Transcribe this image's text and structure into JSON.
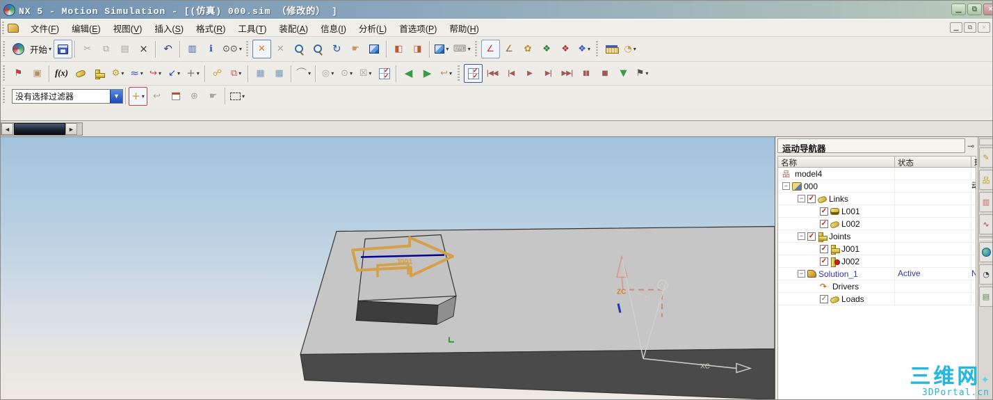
{
  "window": {
    "title": "NX 5 - Motion Simulation - [(仿真) 000.sim （修改的） ]",
    "main_controls": [
      {
        "n": "minimize-button",
        "g": "▁",
        "k": "min"
      },
      {
        "n": "restore-button",
        "g": "⧉",
        "k": "restore"
      },
      {
        "n": "close-button",
        "g": "×",
        "k": "close"
      }
    ],
    "child_controls": [
      {
        "n": "child-minimize-button",
        "g": "▁",
        "k": "min"
      },
      {
        "n": "child-restore-button",
        "g": "⧉",
        "k": "restore"
      },
      {
        "n": "child-close-button",
        "g": "×",
        "k": "close"
      }
    ]
  },
  "menu_bar": {
    "items": [
      {
        "id": "file",
        "label": "文件(F)"
      },
      {
        "id": "edit",
        "label": "编辑(E)"
      },
      {
        "id": "view",
        "label": "视图(V)"
      },
      {
        "id": "insert",
        "label": "插入(S)"
      },
      {
        "id": "format",
        "label": "格式(R)"
      },
      {
        "id": "tools",
        "label": "工具(T)"
      },
      {
        "id": "assemblies",
        "label": "装配(A)"
      },
      {
        "id": "information",
        "label": "信息(I)"
      },
      {
        "id": "analysis",
        "label": "分析(L)"
      },
      {
        "id": "preferences",
        "label": "首选项(P)"
      },
      {
        "id": "help",
        "label": "帮助(H)"
      }
    ]
  },
  "selection_filter": {
    "value": "没有选择过滤器"
  },
  "toolbars": [
    {
      "dom": "toolbar-row-1",
      "groups": [
        {
          "grip": true,
          "items": [
            {
              "n": "nx-logo-icon",
              "cls": "ic-nxlogo",
              "deco": true
            },
            {
              "n": "start-menu-button",
              "lb": "开始",
              "d": 1
            },
            {
              "n": "save-button",
              "cls": "ic-save",
              "box": "#8aa0c0"
            }
          ]
        },
        {
          "items": [
            {
              "n": "cut-button",
              "g": "✂",
              "dis": 1
            },
            {
              "n": "copy-button",
              "g": "⧉",
              "dis": 1
            },
            {
              "n": "paste-button",
              "g": "▤",
              "dis": 1
            },
            {
              "n": "delete-button",
              "g": "×",
              "c": "#333",
              "big": 1
            }
          ]
        },
        {
          "items": [
            {
              "n": "undo-button",
              "g": "↶",
              "c": "#334477",
              "big": 1
            }
          ]
        },
        {
          "items": [
            {
              "n": "display-properties-button",
              "g": "▥",
              "c": "#4466aa"
            },
            {
              "n": "information-button",
              "g": "ℹ",
              "c": "#2a52c8"
            },
            {
              "n": "find-button",
              "g": "⊙⊙",
              "c": "#4a4438",
              "d": 1
            }
          ]
        },
        {
          "grip": true,
          "items": [
            {
              "n": "fit-view-button",
              "g": "✕",
              "c": "#e07820",
              "box": "#5a82c8"
            },
            {
              "n": "fit-selection-button",
              "g": "✕",
              "dis": 1
            },
            {
              "n": "zoom-box-button",
              "cls": "ic-mag"
            },
            {
              "n": "zoom-in-out-button",
              "cls": "ic-mag"
            },
            {
              "n": "rotate-view-button",
              "g": "↻",
              "c": "#2255bb",
              "big": 1
            },
            {
              "n": "pan-view-button",
              "g": "☛",
              "c": "#c89a60"
            },
            {
              "n": "perspective-button",
              "cls": "ic-cube"
            }
          ]
        },
        {
          "items": [
            {
              "n": "move-link-button",
              "g": "◧",
              "c": "#b85a3a"
            },
            {
              "n": "smart-move-button",
              "g": "◨",
              "c": "#b85a3a"
            }
          ]
        },
        {
          "items": [
            {
              "n": "rendering-style-button",
              "cls": "ic-cube",
              "d": 1
            },
            {
              "n": "visualization-button",
              "g": "⌨",
              "c": "#8a8880",
              "d": 1
            }
          ]
        },
        {
          "grip": true,
          "items": [
            {
              "n": "orient-csys-button",
              "g": "∠",
              "c": "#cc3333",
              "box": "#8aa0b8"
            },
            {
              "n": "dynamic-csys-button",
              "g": "∠",
              "c": "#996644"
            },
            {
              "n": "role-palette-button",
              "g": "✿",
              "c": "#cc8833"
            },
            {
              "n": "standard-views-button",
              "g": "❖",
              "c": "#2a7a3a"
            },
            {
              "n": "view-operations-button",
              "g": "❖",
              "c": "#aa3333"
            },
            {
              "n": "more-views-button",
              "g": "❖",
              "c": "#3355cc",
              "d": 1
            }
          ]
        },
        {
          "grip": true,
          "items": [
            {
              "n": "measure-distance-button",
              "cls": "ic-ruler"
            },
            {
              "n": "measure-angle-button",
              "g": "◔",
              "c": "#c8a050",
              "d": 1
            }
          ]
        }
      ]
    },
    {
      "dom": "toolbar-row-2",
      "groups": [
        {
          "grip": true,
          "items": [
            {
              "n": "motion-environment-button",
              "g": "⚑",
              "c": "#cc3344"
            },
            {
              "n": "motion-body-button",
              "g": "▣",
              "c": "#b09060"
            }
          ]
        },
        {
          "items": [
            {
              "n": "function-manager-button",
              "lb": "f(x)",
              "fx": 1
            },
            {
              "n": "link-button",
              "cls": "ic-link"
            },
            {
              "n": "joint-button",
              "cls": "ic-joint"
            },
            {
              "n": "gear-button",
              "g": "⚙",
              "c": "#c89a20",
              "d": 1
            },
            {
              "n": "spring-button",
              "g": "≈",
              "c": "#4455cc",
              "big": 1,
              "d": 1
            },
            {
              "n": "curve-contact-button",
              "g": "↪",
              "c": "#cc4444",
              "d": 1
            },
            {
              "n": "vector-force-button",
              "g": "↙",
              "c": "#2244cc",
              "d": 1
            },
            {
              "n": "marker-button",
              "g": "+",
              "c": "#77736a",
              "big": 1,
              "d": 1
            }
          ]
        },
        {
          "items": [
            {
              "n": "friction-button",
              "g": "☍",
              "c": "#c8a030"
            },
            {
              "n": "interference-button",
              "g": "⧉",
              "c": "#cc5555",
              "d": 1
            }
          ]
        },
        {
          "items": [
            {
              "n": "solve-button",
              "g": "▦",
              "c": "#7799bb"
            },
            {
              "n": "solution-manager-button",
              "g": "▦",
              "c": "#7799bb"
            }
          ]
        },
        {
          "items": [
            {
              "n": "animation-control-button",
              "g": "⌒",
              "c": "#98948c",
              "big": 1,
              "d": 1
            }
          ]
        },
        {
          "items": [
            {
              "n": "graphing-button",
              "g": "◎",
              "dis": 1,
              "d": 1
            },
            {
              "n": "load-identification-button",
              "g": "⊙",
              "dis": 1,
              "d": 1
            },
            {
              "n": "spreadsheet-button",
              "g": "☒",
              "dis": 1,
              "d": 1
            },
            {
              "n": "load-transfer-button",
              "cls": "ic-gridcheck"
            }
          ]
        },
        {
          "items": [
            {
              "n": "previous-step-button",
              "g": "◀",
              "c": "#3a9a4a",
              "big": 1
            },
            {
              "n": "next-step-button",
              "g": "▶",
              "c": "#3a9a4a",
              "big": 1
            },
            {
              "n": "return-to-model-button",
              "g": "↩",
              "c": "#b09868",
              "d": 1
            }
          ]
        },
        {
          "grip": true,
          "items": [
            {
              "n": "animation-check-button",
              "cls": "ic-gridcheck",
              "box": "#3355aa"
            },
            {
              "n": "rewind-button",
              "g": "|◀◀",
              "c": "#a05858",
              "pb": 1
            },
            {
              "n": "step-back-button",
              "g": "|◀",
              "c": "#a05858",
              "pb": 1
            },
            {
              "n": "play-button",
              "g": "▶",
              "c": "#a05858",
              "pb": 1
            },
            {
              "n": "step-forward-button",
              "g": "▶|",
              "c": "#a05858",
              "pb": 1
            },
            {
              "n": "fast-forward-button",
              "g": "▶▶|",
              "c": "#a05858",
              "pb": 1
            },
            {
              "n": "pause-button",
              "g": "▮▮",
              "c": "#a05858",
              "pb": 1
            },
            {
              "n": "stop-button",
              "g": "■",
              "c": "#a05858",
              "pb": 1
            },
            {
              "n": "expand-animation-button",
              "g": "▼",
              "c": "#3a9a4a"
            },
            {
              "n": "finish-flag-button",
              "g": "⚑",
              "c": "#55524a",
              "d": 1
            }
          ]
        }
      ]
    },
    {
      "dom": "toolbar-row-3",
      "groups": [
        {
          "grip": true,
          "items": [
            {
              "n": "selection-filter-combo",
              "combo": 1
            }
          ]
        },
        {
          "items": [
            {
              "n": "general-selection-button",
              "g": "+",
              "c": "#cc9922",
              "big": 1,
              "box": "#cc4444",
              "d": 1
            },
            {
              "n": "deselect-button",
              "g": "↩",
              "dis": 1
            },
            {
              "n": "snap-point-button",
              "cls": "ic-eraser"
            },
            {
              "n": "rotate-point-button",
              "g": "⊕",
              "dis": 1
            },
            {
              "n": "drag-button",
              "g": "☛",
              "dis": 1
            }
          ]
        },
        {
          "items": [
            {
              "n": "rectangle-select-button",
              "cls": "ic-dashrect",
              "d": 1
            }
          ]
        }
      ]
    }
  ],
  "scrollbar": {
    "left": "◄",
    "right": "►"
  },
  "navigator": {
    "title": "运动导航器",
    "pin_icon": "⊸",
    "columns": [
      "名称",
      "状态",
      "环境"
    ],
    "rows": [
      {
        "label": "model4",
        "icon": "model",
        "indent": 0
      },
      {
        "label": "000",
        "icon": "sim",
        "indent": 0,
        "exp": 1,
        "env": "动力学"
      },
      {
        "label": "Links",
        "icon": "links",
        "indent": 1,
        "exp": 1,
        "cb": "red"
      },
      {
        "label": "L001",
        "icon": "ground",
        "indent": 2,
        "cb": "red"
      },
      {
        "label": "L002",
        "icon": "link",
        "indent": 2,
        "cb": "red"
      },
      {
        "label": "Joints",
        "icon": "joint",
        "indent": 1,
        "exp": 1,
        "cb": "red"
      },
      {
        "label": "J001",
        "icon": "joint",
        "indent": 2,
        "cb": "red"
      },
      {
        "label": "J002",
        "icon": "jointgear",
        "indent": 2,
        "cb": "red"
      },
      {
        "label": "Solution_1",
        "icon": "solution",
        "indent": 1,
        "exp": 1,
        "status": "Active",
        "env": "Normal Run",
        "color": "#3333aa"
      },
      {
        "label": "Drivers",
        "icon": "driver",
        "indent": 2
      },
      {
        "label": "Loads",
        "icon": "loads",
        "indent": 2,
        "cb": "gray"
      }
    ]
  },
  "viewport": {
    "labels": {
      "joint": "J001",
      "zc": "ZC",
      "xc": "XC",
      "origin": "C"
    },
    "colors": {
      "slab_top": "#c6c6c6",
      "slab_front": "#4a4a4a",
      "block_front": "#3d3d3d",
      "joint_arrow": "#d4a04a",
      "axis_line": "#000099",
      "ghost": "#d89890"
    }
  },
  "resource_bar": {
    "items": [
      {
        "n": "resource-blank",
        "blank": 1
      },
      {
        "n": "assembly-navigator-tab",
        "g": "✎",
        "c": "#b8962a"
      },
      {
        "n": "part-navigator-tab",
        "g": "品",
        "c": "#c8a020"
      },
      {
        "n": "reuse-library-tab",
        "g": "▥",
        "c": "#cc6666"
      },
      {
        "n": "xy-function-navigator-tab",
        "g": "∿",
        "c": "#aa3344"
      },
      {
        "n": "resource-separator",
        "sep": 1
      },
      {
        "n": "internet-tab",
        "cls": "ic-globe"
      },
      {
        "n": "history-tab",
        "g": "◔",
        "c": "#334455"
      },
      {
        "n": "roles-tab",
        "g": "▤",
        "c": "#558844"
      }
    ]
  },
  "watermark": {
    "line1": "三维网",
    "star": "✦",
    "line2": "3DPortal.cn"
  }
}
